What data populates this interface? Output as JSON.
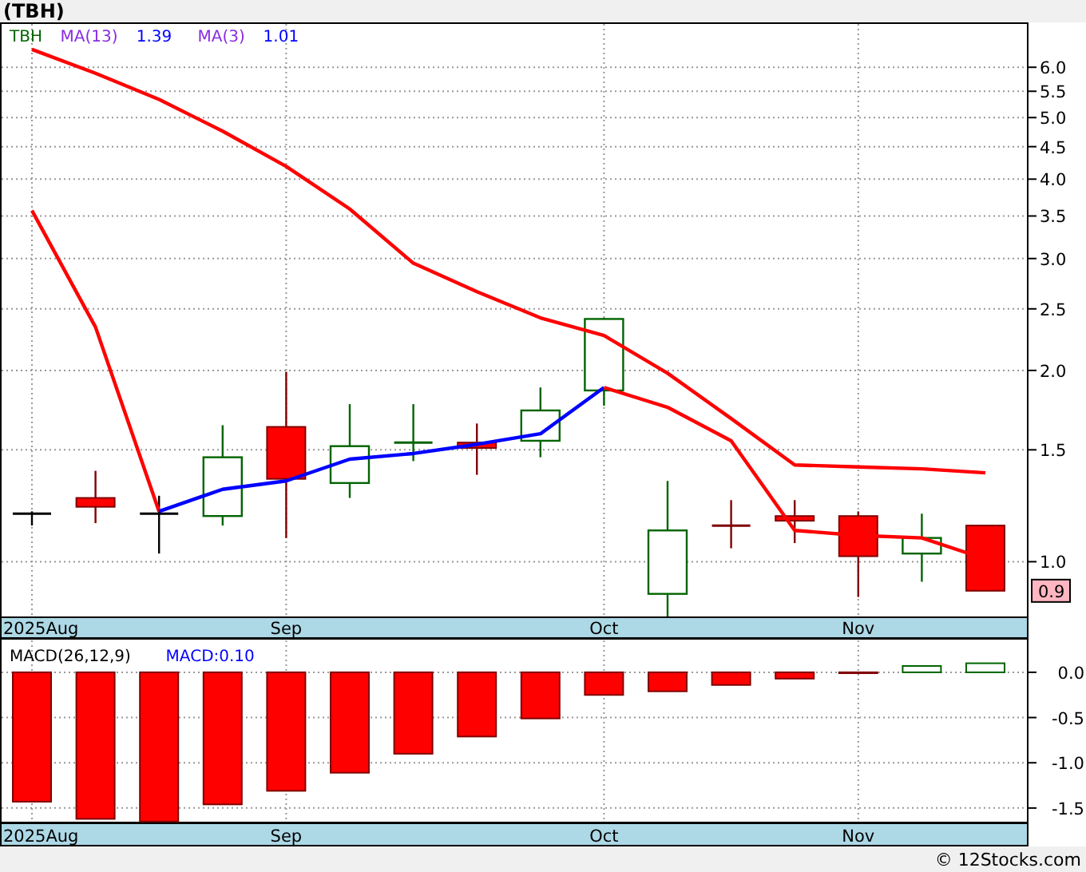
{
  "title": "(TBH)",
  "price_panel": {
    "legend": [
      {
        "text": "TBH",
        "kind": "symbol"
      },
      {
        "text": "MA(13)",
        "kind": "name"
      },
      {
        "text": "1.39",
        "kind": "value"
      },
      {
        "text": "MA(3)",
        "kind": "name"
      },
      {
        "text": "1.01",
        "kind": "value"
      }
    ],
    "axis_labels": [
      "6.0",
      "5.5",
      "5.0",
      "4.5",
      "4.0",
      "3.5",
      "3.0",
      "2.5",
      "2.0",
      "1.5",
      "1.0"
    ],
    "last_price": "0.9",
    "date_labels": [
      "2025Aug",
      "Sep",
      "Oct",
      "Nov"
    ]
  },
  "macd_panel": {
    "reading": "MACD:0.10",
    "chart_data": {
      "type": "bar",
      "grid": true,
      "title": "MACD(26,12,9)",
      "categories": [
        "2025Aug",
        null,
        null,
        null,
        "Sep",
        null,
        null,
        null,
        null,
        "Oct",
        null,
        null,
        null,
        "Nov",
        null,
        null
      ],
      "ylim": [
        -1.66,
        0.37
      ],
      "yticks": [
        {
          "value": 0,
          "label": "0.0"
        },
        {
          "value": -0.5,
          "label": "-0.5"
        },
        {
          "value": -1,
          "label": "-1.0"
        },
        {
          "value": -1.5,
          "label": "-1.5"
        }
      ],
      "values": [
        -1.43,
        -1.62,
        -1.65,
        -1.46,
        -1.31,
        -1.11,
        -0.9,
        -0.71,
        -0.51,
        -0.25,
        -0.21,
        -0.14,
        -0.07,
        -0.01,
        0.07,
        0.1
      ]
    }
  },
  "footer": "© 12Stocks.com"
}
